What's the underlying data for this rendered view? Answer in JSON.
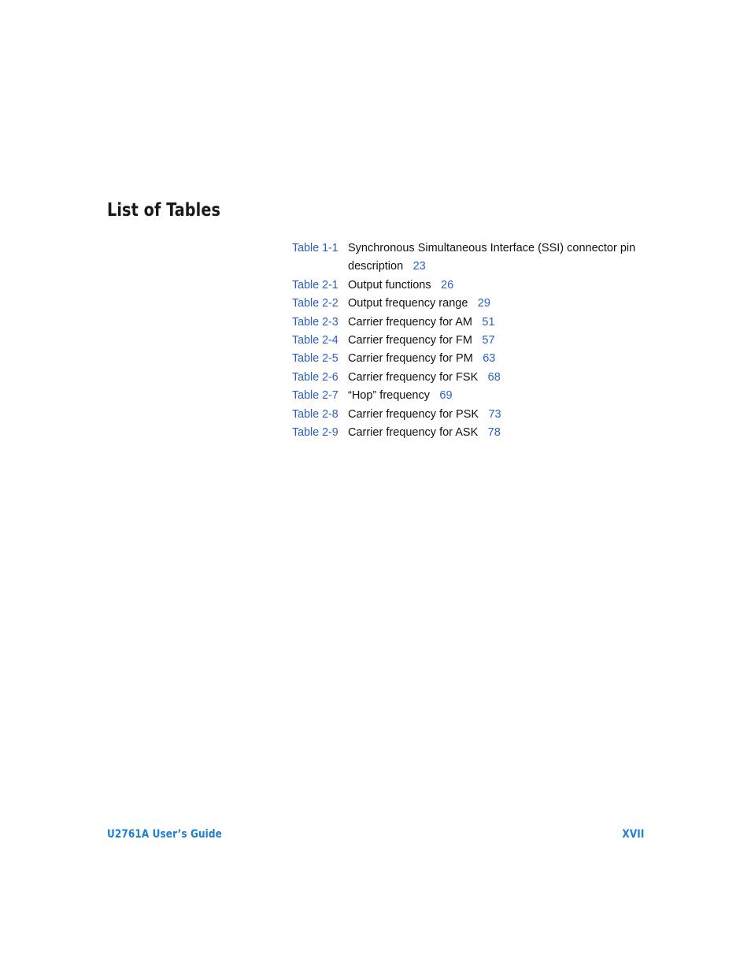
{
  "document": {
    "heading": "List of Tables",
    "label_color": "#2b5fc4",
    "footer_color": "#1b7fd4",
    "text_color": "#121212"
  },
  "entries": [
    {
      "label": "Table 1-1",
      "description": "Synchronous Simultaneous Interface (SSI) connector pin description",
      "page": "23"
    },
    {
      "label": "Table 2-1",
      "description": "Output functions",
      "page": "26"
    },
    {
      "label": "Table 2-2",
      "description": "Output frequency range",
      "page": "29"
    },
    {
      "label": "Table 2-3",
      "description": "Carrier frequency for AM",
      "page": "51"
    },
    {
      "label": "Table 2-4",
      "description": "Carrier frequency for FM",
      "page": "57"
    },
    {
      "label": "Table 2-5",
      "description": "Carrier frequency for PM",
      "page": "63"
    },
    {
      "label": "Table 2-6",
      "description": "Carrier frequency for FSK",
      "page": "68"
    },
    {
      "label": "Table 2-7",
      "description": "“Hop” frequency",
      "page": "69"
    },
    {
      "label": "Table 2-8",
      "description": "Carrier frequency for PSK",
      "page": "73"
    },
    {
      "label": "Table 2-9",
      "description": "Carrier frequency for ASK",
      "page": "78"
    }
  ],
  "footer": {
    "guide_title": "U2761A User’s Guide",
    "page_number": "XVII"
  }
}
